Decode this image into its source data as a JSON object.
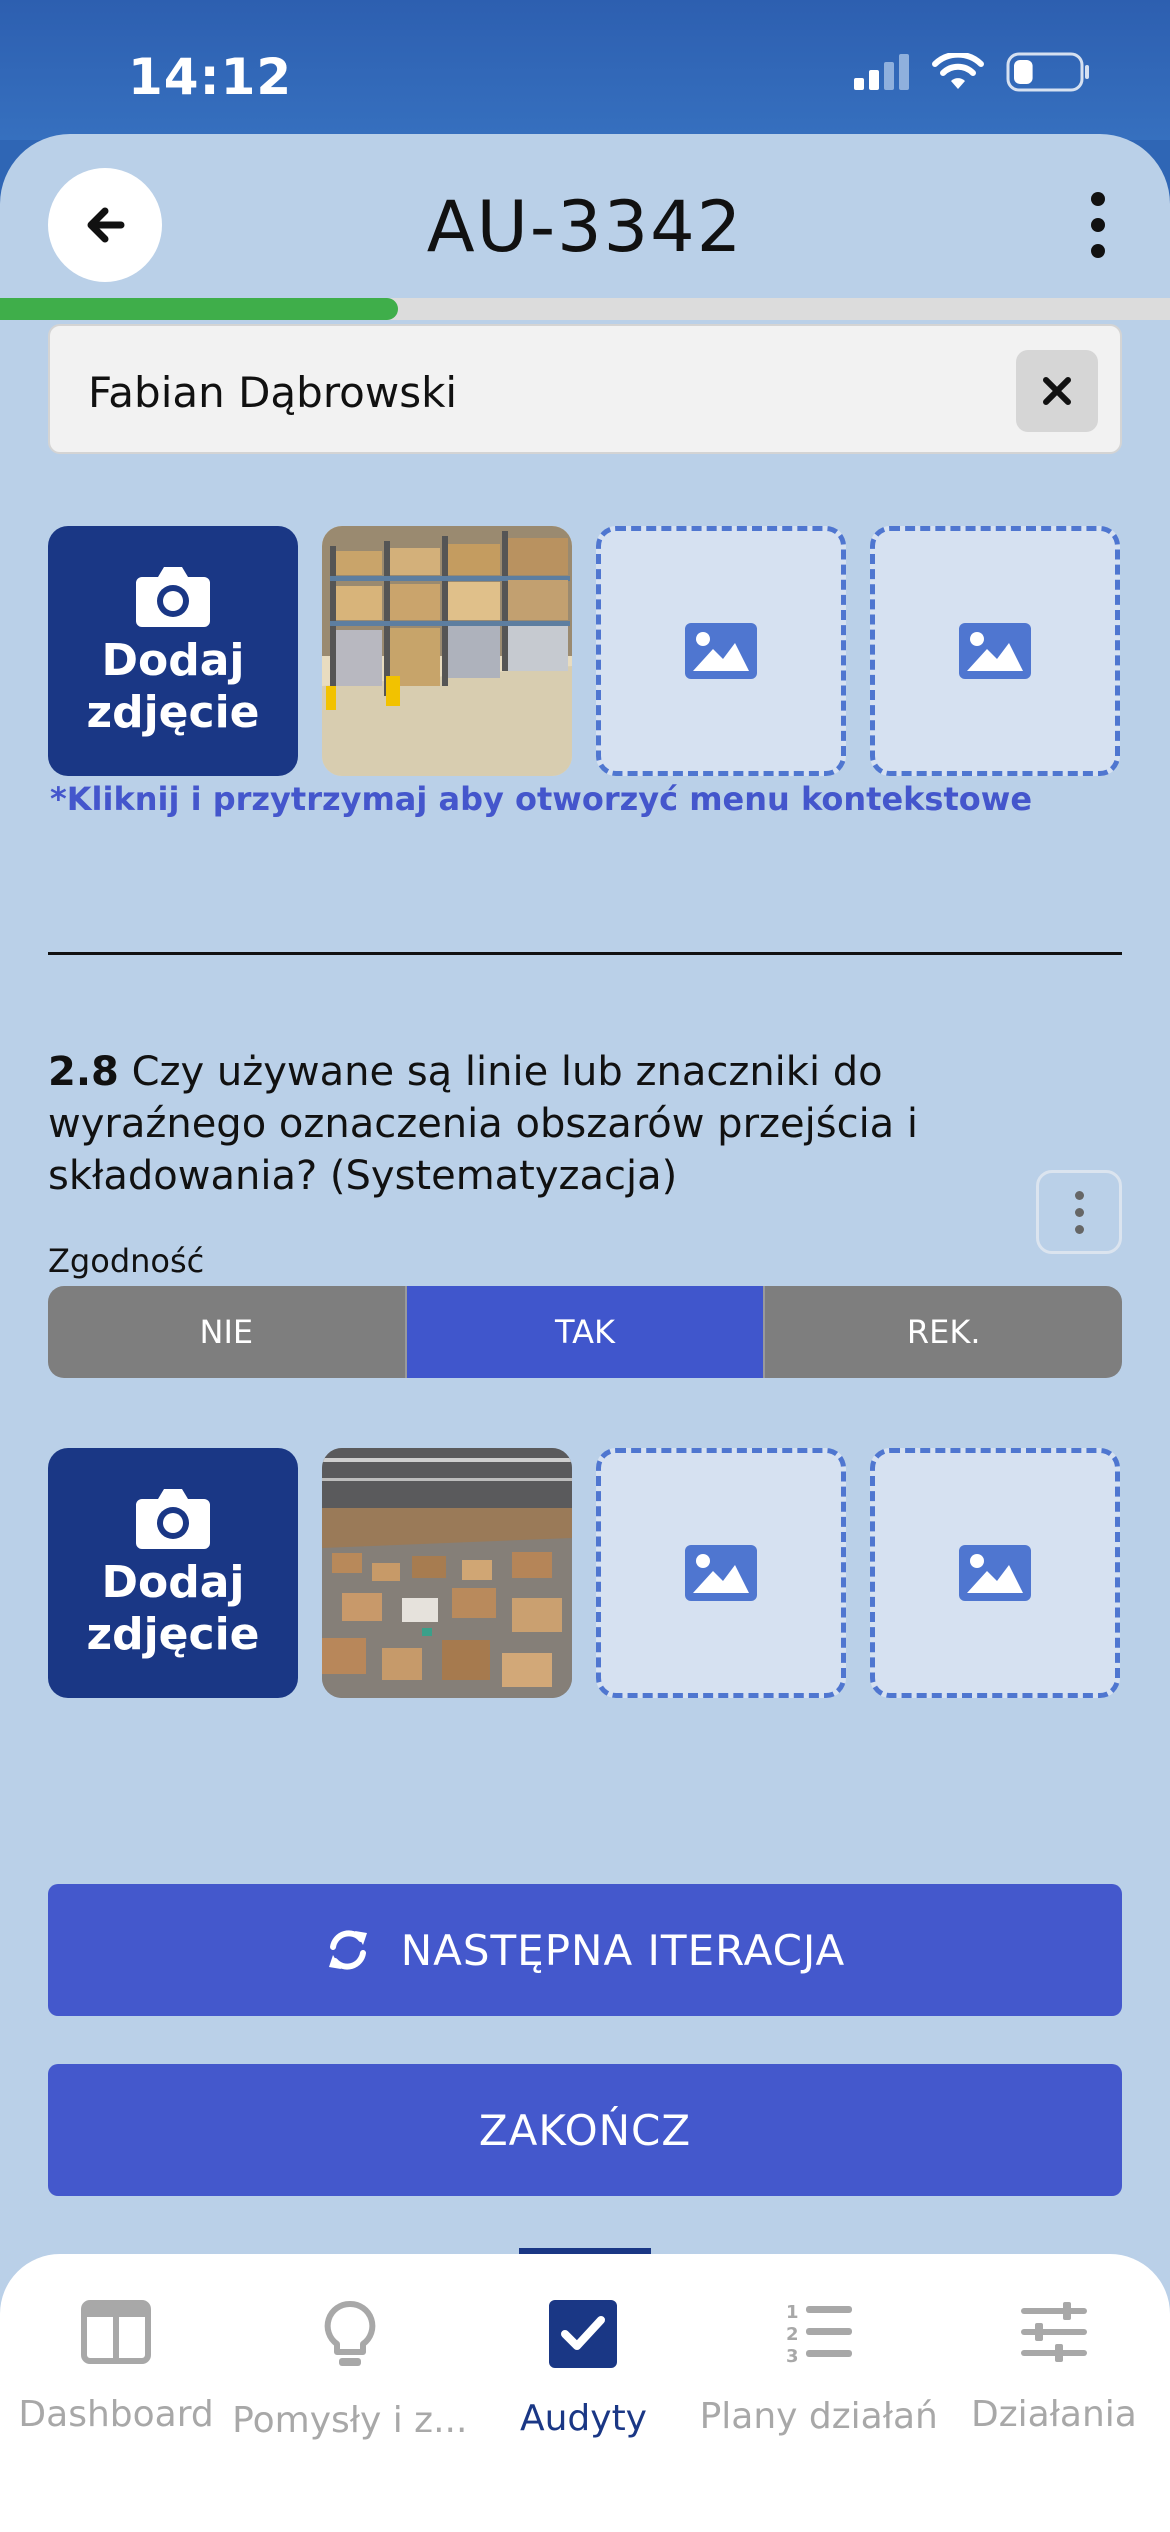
{
  "status": {
    "time": "14:12",
    "battery_level": 0.3
  },
  "header": {
    "title": "AU-3342",
    "back_icon": "arrow-left-icon",
    "menu_icon": "kebab-icon"
  },
  "progress": {
    "fraction": 0.34,
    "color": "#3fae4a"
  },
  "name_field": {
    "value": "Fabian Dąbrowski"
  },
  "photos_section_1": {
    "add_label_line1": "Dodaj",
    "add_label_line2": "zdjęcie",
    "thumbnail": "warehouse-shelves-photo",
    "hint": "*Kliknij i przytrzymaj aby otworzyć menu kontekstowe"
  },
  "question": {
    "number": "2.8",
    "text": "Czy używane są linie lub znaczniki do wyraźnego oznaczenia obszarów przejścia i składowania? (Systematyzacja)",
    "compliance_label": "Zgodność",
    "options": [
      "NIE",
      "TAK",
      "REK."
    ],
    "selected": "TAK"
  },
  "photos_section_2": {
    "add_label_line1": "Dodaj",
    "add_label_line2": "zdjęcie",
    "thumbnail": "messy-warehouse-boxes-photo"
  },
  "actions": {
    "next_iteration": "NASTĘPNA ITERACJA",
    "finish": "ZAKOŃCZ"
  },
  "tabs": [
    {
      "label": "Dashboard",
      "icon": "dashboard-icon"
    },
    {
      "label": "Pomysły i z...",
      "icon": "lightbulb-icon"
    },
    {
      "label": "Audyty",
      "icon": "checkbox-icon",
      "active": true
    },
    {
      "label": "Plany działań",
      "icon": "numbered-list-icon"
    },
    {
      "label": "Działania",
      "icon": "sliders-icon"
    }
  ],
  "colors": {
    "primary": "#4458cc",
    "navy": "#1a3785",
    "background": "#bad0e8"
  }
}
